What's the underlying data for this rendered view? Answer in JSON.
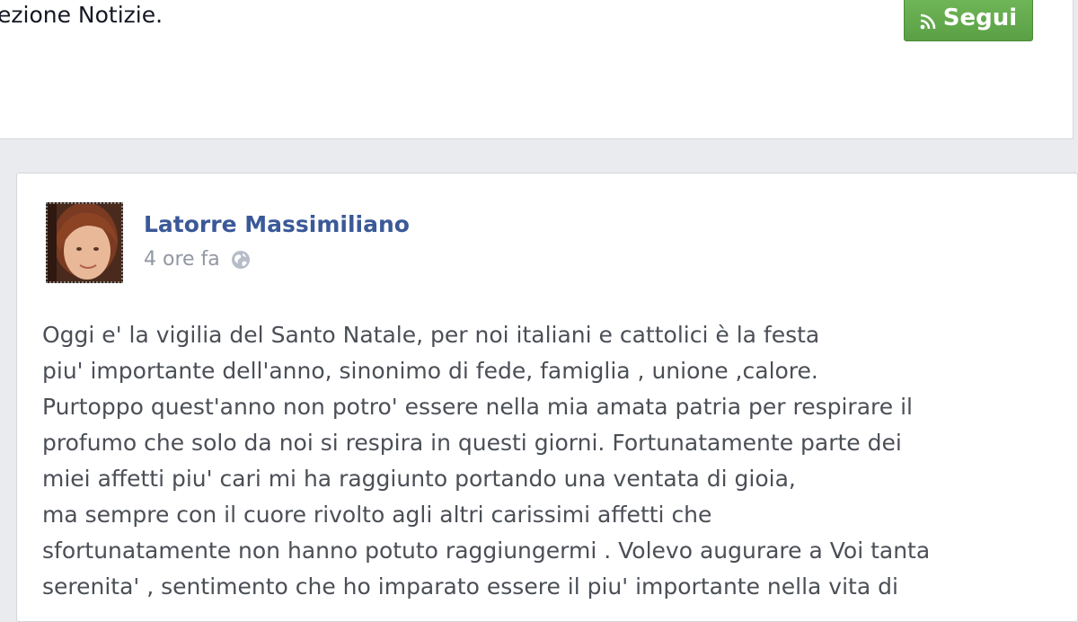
{
  "header": {
    "text": "ezione Notizie.",
    "follow_label": "Segui"
  },
  "post": {
    "author": "Latorre Massimiliano",
    "timestamp": "4 ore fa",
    "lines": [
      "Oggi e' la vigilia del Santo Natale, per noi italiani e cattolici è la festa",
      "piu' importante dell'anno, sinonimo di fede, famiglia , unione ,calore.",
      "Purtoppo quest'anno non potro' essere nella mia amata patria per respirare il",
      "profumo che solo da noi si respira in questi giorni. Fortunatamente parte dei",
      "miei affetti piu' cari mi ha raggiunto portando una ventata di gioia,",
      "ma sempre con il cuore rivolto agli altri carissimi affetti che",
      "sfortunatamente non hanno potuto raggiungermi . Volevo augurare a Voi tanta",
      "serenita' , sentimento che ho imparato essere il piu' importante nella vita di"
    ]
  },
  "icons": {
    "follow": "rss-icon",
    "privacy": "globe-icon",
    "avatar": "profile-photo"
  },
  "colors": {
    "background": "#e9ebee",
    "author_link": "#3b5998",
    "follow_button": "#5fa84a",
    "body_text": "#4b4f56",
    "meta_text": "#9197a3"
  }
}
